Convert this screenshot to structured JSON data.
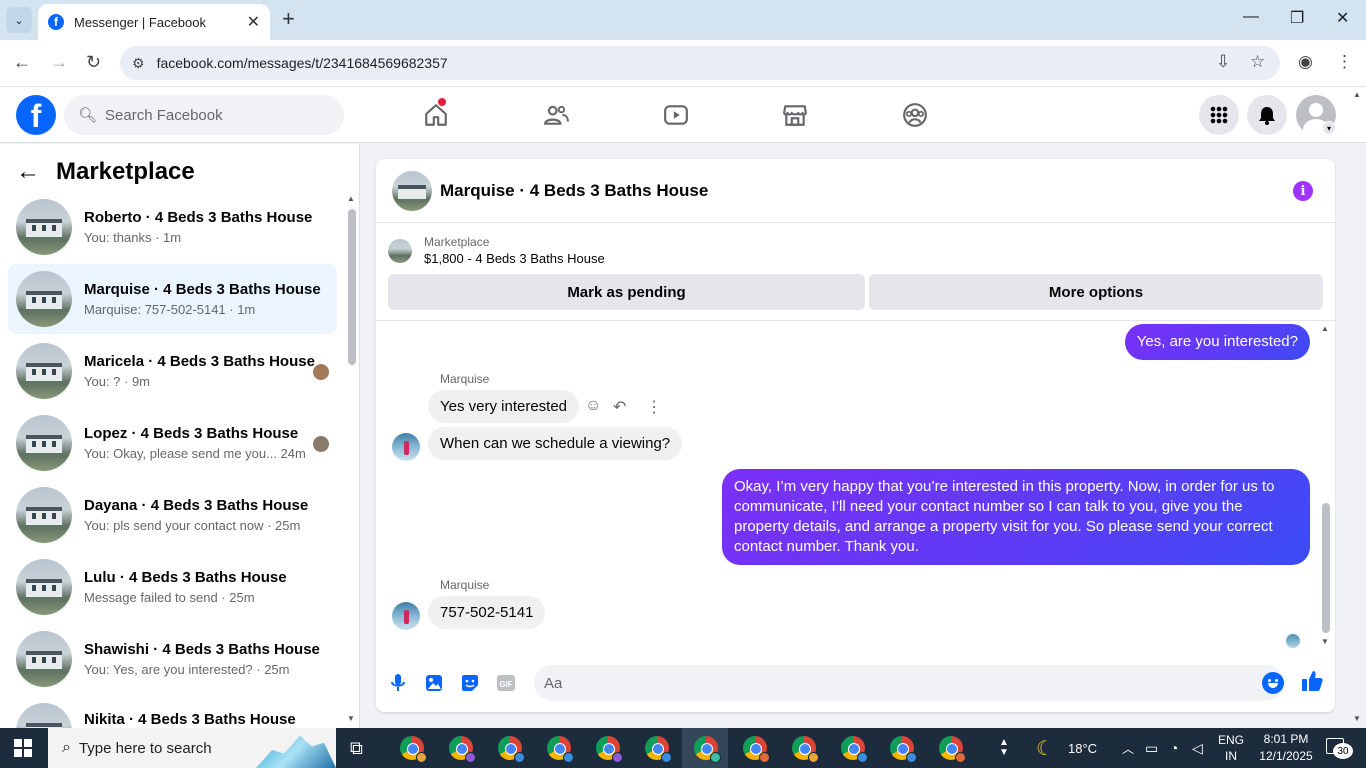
{
  "browser": {
    "tab_title": "Messenger | Facebook",
    "url": "facebook.com/messages/t/2341684569682357"
  },
  "fb": {
    "search_placeholder": "Search Facebook"
  },
  "sidebar": {
    "title": "Marketplace",
    "conversations": [
      {
        "name": "Roberto · 4 Beds 3 Baths House",
        "snippet": "You: thanks · 1m"
      },
      {
        "name": "Marquise · 4 Beds 3 Baths House",
        "snippet": "Marquise: 757-502-5141 · 1m"
      },
      {
        "name": "Maricela · 4 Beds 3 Baths House",
        "snippet": "You: ? · 9m"
      },
      {
        "name": "Lopez · 4 Beds 3 Baths House",
        "snippet": "You: Okay, please send me you... 24m"
      },
      {
        "name": "Dayana · 4 Beds 3 Baths House",
        "snippet": "You: pls send your contact now · 25m"
      },
      {
        "name": "Lulu · 4 Beds 3 Baths House",
        "snippet": "Message failed to send · 25m"
      },
      {
        "name": "Shawishi · 4 Beds 3 Baths House",
        "snippet": "You: Yes, are you interested? · 25m"
      },
      {
        "name": "Nikita · 4 Beds 3 Baths House",
        "snippet": ""
      }
    ]
  },
  "chat": {
    "title": "Marquise · 4 Beds 3 Baths House",
    "listing_label": "Marketplace",
    "listing_price": "$1,800 - 4 Beds 3 Baths House",
    "btn_pending": "Mark as pending",
    "btn_more": "More options",
    "messages": {
      "out1": "Yes, are you interested?",
      "sender1": "Marquise",
      "in1": "Yes very interested",
      "in2": "When can we schedule a viewing?",
      "out2": "Okay, I’m very happy that you’re interested in this property. Now, in order for us to communicate, I’ll need your contact number so I can talk to you, give you the property details, and arrange a property visit for you. So please send your correct contact number. Thank you.",
      "sender2": "Marquise",
      "in3": "757-502-5141"
    },
    "composer_placeholder": "Aa"
  },
  "taskbar": {
    "search_text": "Type here to search",
    "weather": "18°C",
    "lang1": "ENG",
    "lang2": "IN",
    "time": "8:01 PM",
    "date": "12/1/2025",
    "notifications": "30"
  }
}
